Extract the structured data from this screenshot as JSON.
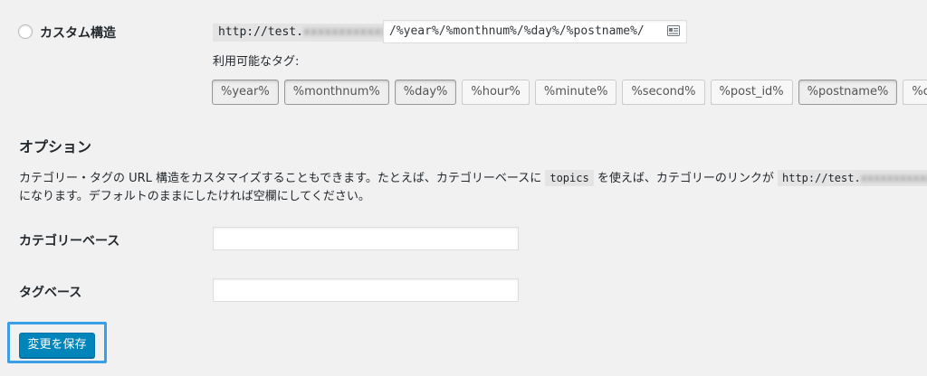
{
  "custom_structure": {
    "label": "カスタム構造",
    "prefix_visible": "http://test.",
    "prefix_obscured": "xxxxxxxxxxxx",
    "value": "/%year%/%monthnum%/%day%/%postname%/",
    "available_tags_label": "利用可能なタグ:"
  },
  "tags": [
    {
      "label": "%year%",
      "active": true
    },
    {
      "label": "%monthnum%",
      "active": true
    },
    {
      "label": "%day%",
      "active": true
    },
    {
      "label": "%hour%",
      "active": false
    },
    {
      "label": "%minute%",
      "active": false
    },
    {
      "label": "%second%",
      "active": false
    },
    {
      "label": "%post_id%",
      "active": false
    },
    {
      "label": "%postname%",
      "active": true
    },
    {
      "label": "%category%",
      "active": false
    }
  ],
  "options": {
    "title": "オプション",
    "desc_part1": "カテゴリー・タグの URL 構造をカスタマイズすることもできます。たとえば、カテゴリーベースに",
    "desc_code1": "topics",
    "desc_part2": "を使えば、カテゴリーのリンクが",
    "desc_code2_visible": "http://test.",
    "desc_code2_obscured": "xxxxxxxxxxxxxx/t",
    "desc_line2": "になります。デフォルトのままにしたければ空欄にしてください。"
  },
  "fields": {
    "category_base_label": "カテゴリーベース",
    "category_base_value": "",
    "tag_base_label": "タグベース",
    "tag_base_value": ""
  },
  "save_button_label": "変更を保存",
  "colors": {
    "primary": "#0085ba",
    "highlight": "#3a9ee8",
    "background": "#f1f1f1"
  }
}
